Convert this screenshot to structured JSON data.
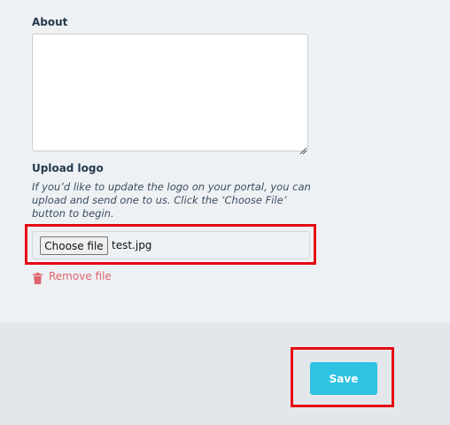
{
  "about": {
    "label": "About",
    "value": ""
  },
  "upload": {
    "label": "Upload logo",
    "help_text": "If you’d like to update the logo on your portal, you can upload and send one to us. Click the ‘Choose File’ button to begin.",
    "choose_button_label": "Choose file",
    "file_name": "test.jpg",
    "remove_label": "Remove file"
  },
  "footer": {
    "save_label": "Save"
  },
  "colors": {
    "accent": "#2fc2e3",
    "danger": "#e06570",
    "highlight": "#e50914"
  },
  "icons": {
    "remove": "trash-icon",
    "textarea_resize": "resize-grip-icon"
  }
}
